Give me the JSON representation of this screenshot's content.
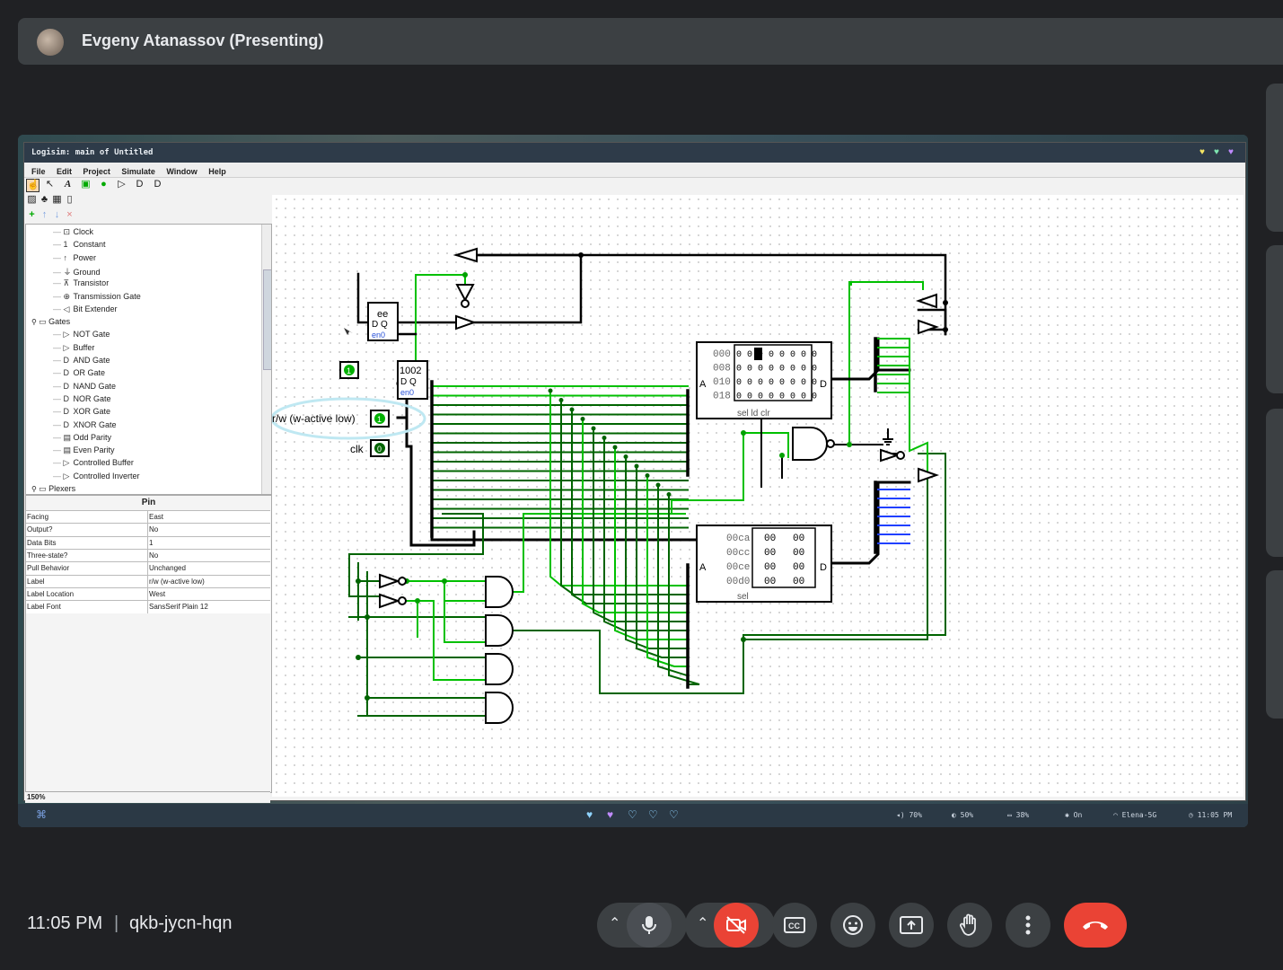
{
  "meet": {
    "presenter": "Evgeny Atanassov (Presenting)",
    "time": "11:05 PM",
    "separator": "|",
    "meeting_code": "qkb-jycn-hqn"
  },
  "logisim": {
    "window_title": "Logisim: main of Untitled",
    "menu": [
      "File",
      "Edit",
      "Project",
      "Simulate",
      "Window",
      "Help"
    ],
    "tree": [
      {
        "icon": "clock-icon",
        "glyph": "⊡",
        "label": "Clock"
      },
      {
        "icon": "constant-icon",
        "glyph": "1",
        "label": "Constant"
      },
      {
        "icon": "power-icon",
        "glyph": "↑",
        "label": "Power"
      },
      {
        "icon": "ground-icon",
        "glyph": "⏚",
        "label": "Ground"
      },
      {
        "icon": "transistor-icon",
        "glyph": "⊼",
        "label": "Transistor"
      },
      {
        "icon": "transmission-gate-icon",
        "glyph": "⊕",
        "label": "Transmission Gate"
      },
      {
        "icon": "bit-extender-icon",
        "glyph": "◁",
        "label": "Bit Extender"
      },
      {
        "icon": "folder-icon",
        "glyph": "▭",
        "label": "Gates"
      },
      {
        "icon": "not-gate-icon",
        "glyph": "▷",
        "label": "NOT Gate"
      },
      {
        "icon": "buffer-icon",
        "glyph": "▷",
        "label": "Buffer"
      },
      {
        "icon": "and-gate-icon",
        "glyph": "D",
        "label": "AND Gate"
      },
      {
        "icon": "or-gate-icon",
        "glyph": "D",
        "label": "OR Gate"
      },
      {
        "icon": "nand-gate-icon",
        "glyph": "D",
        "label": "NAND Gate"
      },
      {
        "icon": "nor-gate-icon",
        "glyph": "D",
        "label": "NOR Gate"
      },
      {
        "icon": "xor-gate-icon",
        "glyph": "D",
        "label": "XOR Gate"
      },
      {
        "icon": "xnor-gate-icon",
        "glyph": "D",
        "label": "XNOR Gate"
      },
      {
        "icon": "odd-parity-icon",
        "glyph": "▤",
        "label": "Odd Parity"
      },
      {
        "icon": "even-parity-icon",
        "glyph": "▤",
        "label": "Even Parity"
      },
      {
        "icon": "controlled-buffer-icon",
        "glyph": "▷",
        "label": "Controlled Buffer"
      },
      {
        "icon": "controlled-inverter-icon",
        "glyph": "▷",
        "label": "Controlled Inverter"
      },
      {
        "icon": "folder-icon",
        "glyph": "▭",
        "label": "Plexers"
      }
    ],
    "attr_title": "Pin",
    "attributes": [
      {
        "key": "Facing",
        "value": "East"
      },
      {
        "key": "Output?",
        "value": "No"
      },
      {
        "key": "Data Bits",
        "value": "1"
      },
      {
        "key": "Three-state?",
        "value": "No"
      },
      {
        "key": "Pull Behavior",
        "value": "Unchanged"
      },
      {
        "key": "Label",
        "value": "r/w (w-active low)"
      },
      {
        "key": "Label Location",
        "value": "West"
      },
      {
        "key": "Label Font",
        "value": "SansSerif Plain 12"
      }
    ],
    "zoom": "150%",
    "circuit": {
      "reg1_label": "ee",
      "reg1_dq": "D  Q",
      "reg1_sub": "en0",
      "reg2_label": "1002",
      "reg2_dq": "D  Q",
      "reg2_sub": "en0",
      "pin_one": "1",
      "rw_label": "r/w (w-active low)",
      "rw_value": "1",
      "clk_label": "clk",
      "clk_value": "0",
      "ram_rows": [
        {
          "addr": "000",
          "cells": "0 0 e 0 0 0 0 0"
        },
        {
          "addr": "008",
          "cells": "0 0 0 0 0 0 0 0"
        },
        {
          "addr": "010",
          "cells": "0 0 0 0 0 0 0 0"
        },
        {
          "addr": "018",
          "cells": "0 0 0 0 0 0 0 0"
        }
      ],
      "ram_a": "A",
      "ram_d": "D",
      "ram_pins": "sel          ld  clr",
      "rom_rows": [
        {
          "addr": "00ca",
          "c1": "00",
          "c2": "00"
        },
        {
          "addr": "00cc",
          "c1": "00",
          "c2": "00"
        },
        {
          "addr": "00ce",
          "c1": "00",
          "c2": "00"
        },
        {
          "addr": "00d0",
          "c1": "00",
          "c2": "00"
        }
      ],
      "rom_a": "A",
      "rom_d": "D",
      "rom_sel": "sel"
    }
  },
  "taskbar": {
    "status": [
      {
        "icon": "volume-icon",
        "text": "70%"
      },
      {
        "icon": "brightness-icon",
        "text": "50%"
      },
      {
        "icon": "battery-icon",
        "text": "38%"
      },
      {
        "icon": "bluetooth-icon",
        "text": "On"
      },
      {
        "icon": "wifi-icon",
        "text": "Elena-5G"
      },
      {
        "icon": "clock-icon",
        "text": "11:05 PM"
      }
    ]
  },
  "colors": {
    "wire_dark": "#006400",
    "wire_light": "#00c000",
    "meet_red": "#ea4335",
    "meet_bg": "#202124",
    "control_bg": "#3c4043"
  }
}
